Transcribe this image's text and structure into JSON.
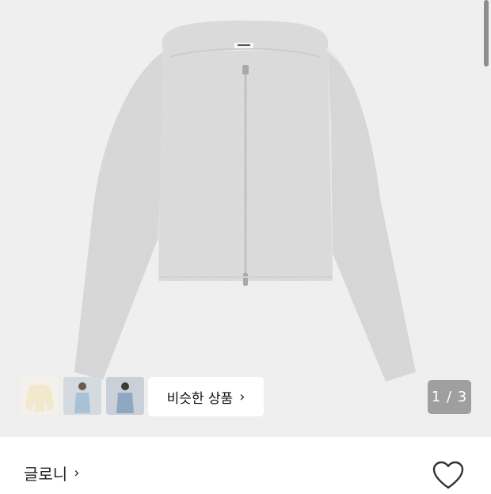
{
  "gallery": {
    "similar_products_label": "비슷한 상품",
    "similar_products_chevron": "›",
    "pager_text": "1 / 3",
    "thumbnails": [
      "thumbnail-1",
      "thumbnail-2",
      "thumbnail-3"
    ]
  },
  "product": {
    "brand_name": "글로니",
    "brand_chevron": "›",
    "wishlist_icon": "heart-outline-icon"
  },
  "colors": {
    "hero_background": "#efefef",
    "pager_background": "#9f9f9f",
    "garment": "#dcdcdc"
  }
}
